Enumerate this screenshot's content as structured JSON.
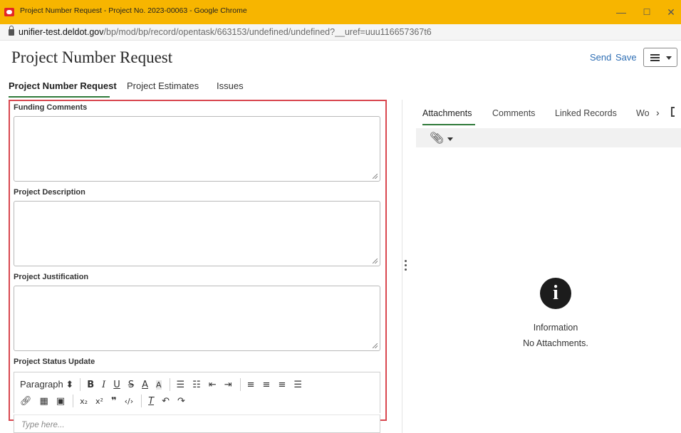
{
  "window": {
    "title": "Project Number Request - Project No. 2023-00063 - Google Chrome",
    "minimize": "—",
    "maximize": "☐",
    "close": "✕"
  },
  "urlbar": {
    "domain": "unifier-test.deldot.gov",
    "path": "/bp/mod/bp/record/opentask/663153/undefined/undefined?__uref=uuu116657367t6"
  },
  "header": {
    "title": "Project Number Request",
    "send_label": "Send",
    "save_label": "Save"
  },
  "tabs": [
    {
      "label": "Project Number Request",
      "active": true
    },
    {
      "label": "Project Estimates",
      "active": false
    },
    {
      "label": "Issues",
      "active": false
    }
  ],
  "form": {
    "funding_comments_label": "Funding Comments",
    "project_description_label": "Project Description",
    "project_justification_label": "Project Justification",
    "project_status_update_label": "Project Status Update",
    "rte_format": "Paragraph",
    "rte_placeholder": "Type here..."
  },
  "right_panel": {
    "tabs": [
      "Attachments",
      "Comments",
      "Linked Records",
      "Wo"
    ],
    "info_title": "Information",
    "info_message": "No Attachments."
  }
}
